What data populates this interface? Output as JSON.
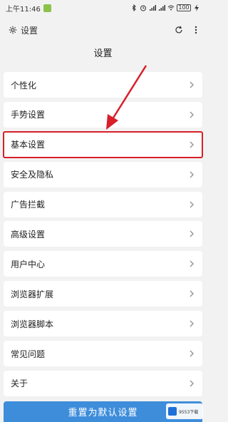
{
  "status_bar": {
    "time": "上午11:46",
    "battery": "100"
  },
  "app_bar": {
    "title": "设置",
    "icons": [
      "gear-icon",
      "refresh-icon",
      "more-icon"
    ]
  },
  "page": {
    "title": "设置"
  },
  "settings": {
    "items": [
      {
        "label": "个性化"
      },
      {
        "label": "手势设置"
      },
      {
        "label": "基本设置",
        "highlighted": true
      },
      {
        "label": "安全及隐私"
      },
      {
        "label": "广告拦截"
      },
      {
        "label": "高级设置"
      },
      {
        "label": "用户中心"
      },
      {
        "label": "浏览器扩展"
      },
      {
        "label": "浏览器脚本"
      },
      {
        "label": "常见问题"
      },
      {
        "label": "关于"
      }
    ]
  },
  "reset": {
    "label": "重置为默认设置"
  },
  "colors": {
    "highlight": "#d81f2a",
    "button": "#3e8ddb"
  }
}
